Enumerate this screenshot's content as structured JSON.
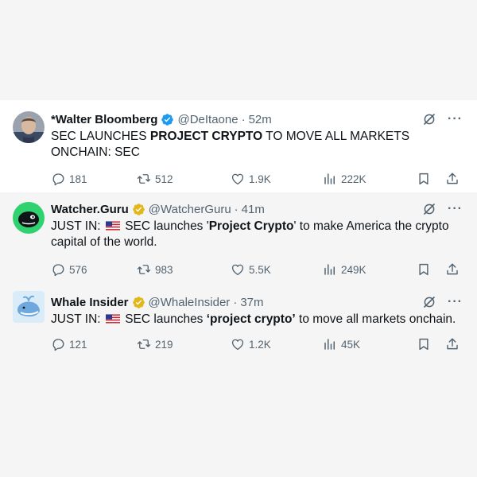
{
  "colors": {
    "verified_blue": "#1d9bf0",
    "verified_gold": "#e2b719",
    "secondary_text": "#536471"
  },
  "tweets": [
    {
      "name": "*Walter Bloomberg",
      "badge": "blue-verified-icon",
      "handle": "@DeItaone",
      "sep": "·",
      "time": "52m",
      "text_before": "SEC LAUNCHES ",
      "text_bold": "PROJECT CRYPTO",
      "text_after": " TO MOVE ALL MARKETS ONCHAIN: SEC",
      "replies": "181",
      "reposts": "512",
      "likes": "1.9K",
      "views": "222K"
    },
    {
      "name": "Watcher.Guru",
      "badge": "gold-verified-icon",
      "handle": "@WatcherGuru",
      "sep": "·",
      "time": "41m",
      "text_prefix": "JUST IN:",
      "text_before": " SEC launches '",
      "text_bold": "Project Crypto",
      "text_after": "' to make America the crypto capital of the world.",
      "replies": "576",
      "reposts": "983",
      "likes": "5.5K",
      "views": "249K"
    },
    {
      "name": "Whale Insider",
      "badge": "gold-verified-icon",
      "handle": "@WhaleInsider",
      "sep": "·",
      "time": "37m",
      "text_prefix": "JUST IN:",
      "text_before": " SEC launches ",
      "text_bold": "‘project crypto’",
      "text_after": " to move all markets onchain.",
      "replies": "121",
      "reposts": "219",
      "likes": "1.2K",
      "views": "45K"
    }
  ]
}
